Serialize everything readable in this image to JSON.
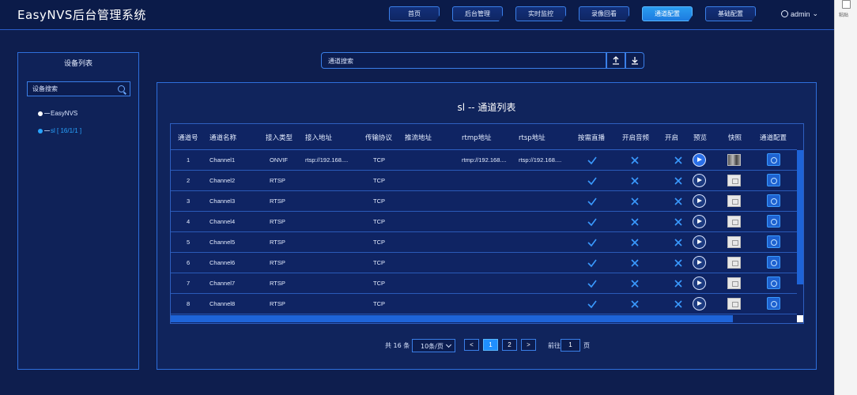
{
  "app": {
    "title": "EasyNVS后台管理系统"
  },
  "nav": {
    "tabs": [
      {
        "label": "首页",
        "active": false
      },
      {
        "label": "后台管理",
        "active": false
      },
      {
        "label": "实时监控",
        "active": false
      },
      {
        "label": "录像回看",
        "active": false
      },
      {
        "label": "通道配置",
        "active": true
      },
      {
        "label": "基础配置",
        "active": false
      }
    ],
    "user": "admin"
  },
  "system": {
    "paste_label": "粘贴"
  },
  "sidebar": {
    "title": "设备列表",
    "search_placeholder": "设备搜索",
    "items": [
      {
        "label": "EasyNVS",
        "selected": false
      },
      {
        "label": "sl [ 16/1/1 ]",
        "selected": true
      }
    ]
  },
  "channel_search": {
    "placeholder": "通道搜索",
    "upload_icon": "upload-icon",
    "download_icon": "download-icon"
  },
  "main": {
    "title": "sl -- 通道列表",
    "columns": [
      "通道号",
      "通道名称",
      "接入类型",
      "接入地址",
      "传输协议",
      "推流地址",
      "rtmp地址",
      "rtsp地址",
      "按需直播",
      "开启音频",
      "开启",
      "预览",
      "快照",
      "通道配置"
    ],
    "rows": [
      {
        "no": "1",
        "name": "Channel1",
        "type": "ONVIF",
        "addr": "rtsp://192.168....",
        "proto": "TCP",
        "push": "",
        "rtmp": "rtmp://192.168....",
        "rtsp": "rtsp://192.168....",
        "ondemand": true,
        "audio": false,
        "other": false,
        "snapshot": "dark"
      },
      {
        "no": "2",
        "name": "Channel2",
        "type": "RTSP",
        "addr": "",
        "proto": "TCP",
        "push": "",
        "rtmp": "",
        "rtsp": "",
        "ondemand": true,
        "audio": false,
        "other": false,
        "snapshot": "light"
      },
      {
        "no": "3",
        "name": "Channel3",
        "type": "RTSP",
        "addr": "",
        "proto": "TCP",
        "push": "",
        "rtmp": "",
        "rtsp": "",
        "ondemand": true,
        "audio": false,
        "other": false,
        "snapshot": "light"
      },
      {
        "no": "4",
        "name": "Channel4",
        "type": "RTSP",
        "addr": "",
        "proto": "TCP",
        "push": "",
        "rtmp": "",
        "rtsp": "",
        "ondemand": true,
        "audio": false,
        "other": false,
        "snapshot": "light"
      },
      {
        "no": "5",
        "name": "Channel5",
        "type": "RTSP",
        "addr": "",
        "proto": "TCP",
        "push": "",
        "rtmp": "",
        "rtsp": "",
        "ondemand": true,
        "audio": false,
        "other": false,
        "snapshot": "light"
      },
      {
        "no": "6",
        "name": "Channel6",
        "type": "RTSP",
        "addr": "",
        "proto": "TCP",
        "push": "",
        "rtmp": "",
        "rtsp": "",
        "ondemand": true,
        "audio": false,
        "other": false,
        "snapshot": "light"
      },
      {
        "no": "7",
        "name": "Channel7",
        "type": "RTSP",
        "addr": "",
        "proto": "TCP",
        "push": "",
        "rtmp": "",
        "rtsp": "",
        "ondemand": true,
        "audio": false,
        "other": false,
        "snapshot": "light"
      },
      {
        "no": "8",
        "name": "Channel8",
        "type": "RTSP",
        "addr": "",
        "proto": "TCP",
        "push": "",
        "rtmp": "",
        "rtsp": "",
        "ondemand": true,
        "audio": false,
        "other": false,
        "snapshot": "light"
      }
    ]
  },
  "pagination": {
    "total_text": "共 16 条",
    "page_size": "10条/页",
    "prev": "<",
    "pages": [
      "1",
      "2"
    ],
    "current": "1",
    "next": ">",
    "goto_label": "前往",
    "goto_value": "1",
    "page_suffix": "页"
  },
  "colors": {
    "check": "#3a9aff",
    "cross": "#3a9aff",
    "accent": "#1f8fff"
  }
}
